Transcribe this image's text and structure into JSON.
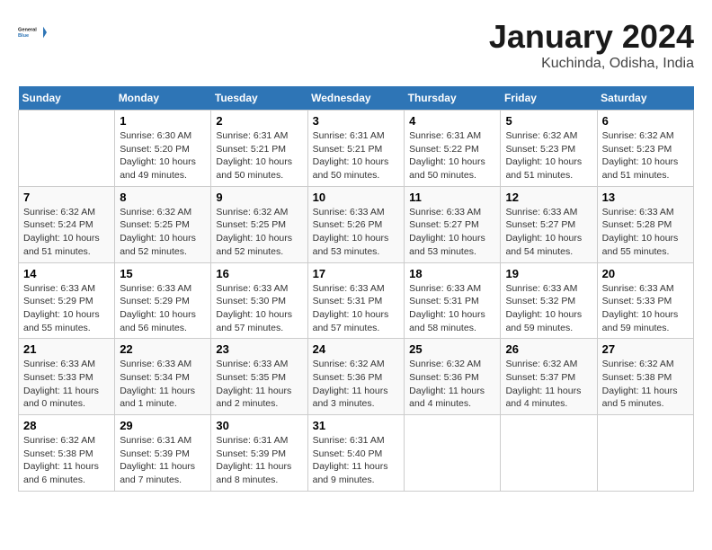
{
  "header": {
    "logo_line1": "General",
    "logo_line2": "Blue",
    "month": "January 2024",
    "location": "Kuchinda, Odisha, India"
  },
  "columns": [
    "Sunday",
    "Monday",
    "Tuesday",
    "Wednesday",
    "Thursday",
    "Friday",
    "Saturday"
  ],
  "weeks": [
    [
      {
        "day": "",
        "content": ""
      },
      {
        "day": "1",
        "content": "Sunrise: 6:30 AM\nSunset: 5:20 PM\nDaylight: 10 hours\nand 49 minutes."
      },
      {
        "day": "2",
        "content": "Sunrise: 6:31 AM\nSunset: 5:21 PM\nDaylight: 10 hours\nand 50 minutes."
      },
      {
        "day": "3",
        "content": "Sunrise: 6:31 AM\nSunset: 5:21 PM\nDaylight: 10 hours\nand 50 minutes."
      },
      {
        "day": "4",
        "content": "Sunrise: 6:31 AM\nSunset: 5:22 PM\nDaylight: 10 hours\nand 50 minutes."
      },
      {
        "day": "5",
        "content": "Sunrise: 6:32 AM\nSunset: 5:23 PM\nDaylight: 10 hours\nand 51 minutes."
      },
      {
        "day": "6",
        "content": "Sunrise: 6:32 AM\nSunset: 5:23 PM\nDaylight: 10 hours\nand 51 minutes."
      }
    ],
    [
      {
        "day": "7",
        "content": "Sunrise: 6:32 AM\nSunset: 5:24 PM\nDaylight: 10 hours\nand 51 minutes."
      },
      {
        "day": "8",
        "content": "Sunrise: 6:32 AM\nSunset: 5:25 PM\nDaylight: 10 hours\nand 52 minutes."
      },
      {
        "day": "9",
        "content": "Sunrise: 6:32 AM\nSunset: 5:25 PM\nDaylight: 10 hours\nand 52 minutes."
      },
      {
        "day": "10",
        "content": "Sunrise: 6:33 AM\nSunset: 5:26 PM\nDaylight: 10 hours\nand 53 minutes."
      },
      {
        "day": "11",
        "content": "Sunrise: 6:33 AM\nSunset: 5:27 PM\nDaylight: 10 hours\nand 53 minutes."
      },
      {
        "day": "12",
        "content": "Sunrise: 6:33 AM\nSunset: 5:27 PM\nDaylight: 10 hours\nand 54 minutes."
      },
      {
        "day": "13",
        "content": "Sunrise: 6:33 AM\nSunset: 5:28 PM\nDaylight: 10 hours\nand 55 minutes."
      }
    ],
    [
      {
        "day": "14",
        "content": "Sunrise: 6:33 AM\nSunset: 5:29 PM\nDaylight: 10 hours\nand 55 minutes."
      },
      {
        "day": "15",
        "content": "Sunrise: 6:33 AM\nSunset: 5:29 PM\nDaylight: 10 hours\nand 56 minutes."
      },
      {
        "day": "16",
        "content": "Sunrise: 6:33 AM\nSunset: 5:30 PM\nDaylight: 10 hours\nand 57 minutes."
      },
      {
        "day": "17",
        "content": "Sunrise: 6:33 AM\nSunset: 5:31 PM\nDaylight: 10 hours\nand 57 minutes."
      },
      {
        "day": "18",
        "content": "Sunrise: 6:33 AM\nSunset: 5:31 PM\nDaylight: 10 hours\nand 58 minutes."
      },
      {
        "day": "19",
        "content": "Sunrise: 6:33 AM\nSunset: 5:32 PM\nDaylight: 10 hours\nand 59 minutes."
      },
      {
        "day": "20",
        "content": "Sunrise: 6:33 AM\nSunset: 5:33 PM\nDaylight: 10 hours\nand 59 minutes."
      }
    ],
    [
      {
        "day": "21",
        "content": "Sunrise: 6:33 AM\nSunset: 5:33 PM\nDaylight: 11 hours\nand 0 minutes."
      },
      {
        "day": "22",
        "content": "Sunrise: 6:33 AM\nSunset: 5:34 PM\nDaylight: 11 hours\nand 1 minute."
      },
      {
        "day": "23",
        "content": "Sunrise: 6:33 AM\nSunset: 5:35 PM\nDaylight: 11 hours\nand 2 minutes."
      },
      {
        "day": "24",
        "content": "Sunrise: 6:32 AM\nSunset: 5:36 PM\nDaylight: 11 hours\nand 3 minutes."
      },
      {
        "day": "25",
        "content": "Sunrise: 6:32 AM\nSunset: 5:36 PM\nDaylight: 11 hours\nand 4 minutes."
      },
      {
        "day": "26",
        "content": "Sunrise: 6:32 AM\nSunset: 5:37 PM\nDaylight: 11 hours\nand 4 minutes."
      },
      {
        "day": "27",
        "content": "Sunrise: 6:32 AM\nSunset: 5:38 PM\nDaylight: 11 hours\nand 5 minutes."
      }
    ],
    [
      {
        "day": "28",
        "content": "Sunrise: 6:32 AM\nSunset: 5:38 PM\nDaylight: 11 hours\nand 6 minutes."
      },
      {
        "day": "29",
        "content": "Sunrise: 6:31 AM\nSunset: 5:39 PM\nDaylight: 11 hours\nand 7 minutes."
      },
      {
        "day": "30",
        "content": "Sunrise: 6:31 AM\nSunset: 5:39 PM\nDaylight: 11 hours\nand 8 minutes."
      },
      {
        "day": "31",
        "content": "Sunrise: 6:31 AM\nSunset: 5:40 PM\nDaylight: 11 hours\nand 9 minutes."
      },
      {
        "day": "",
        "content": ""
      },
      {
        "day": "",
        "content": ""
      },
      {
        "day": "",
        "content": ""
      }
    ]
  ]
}
